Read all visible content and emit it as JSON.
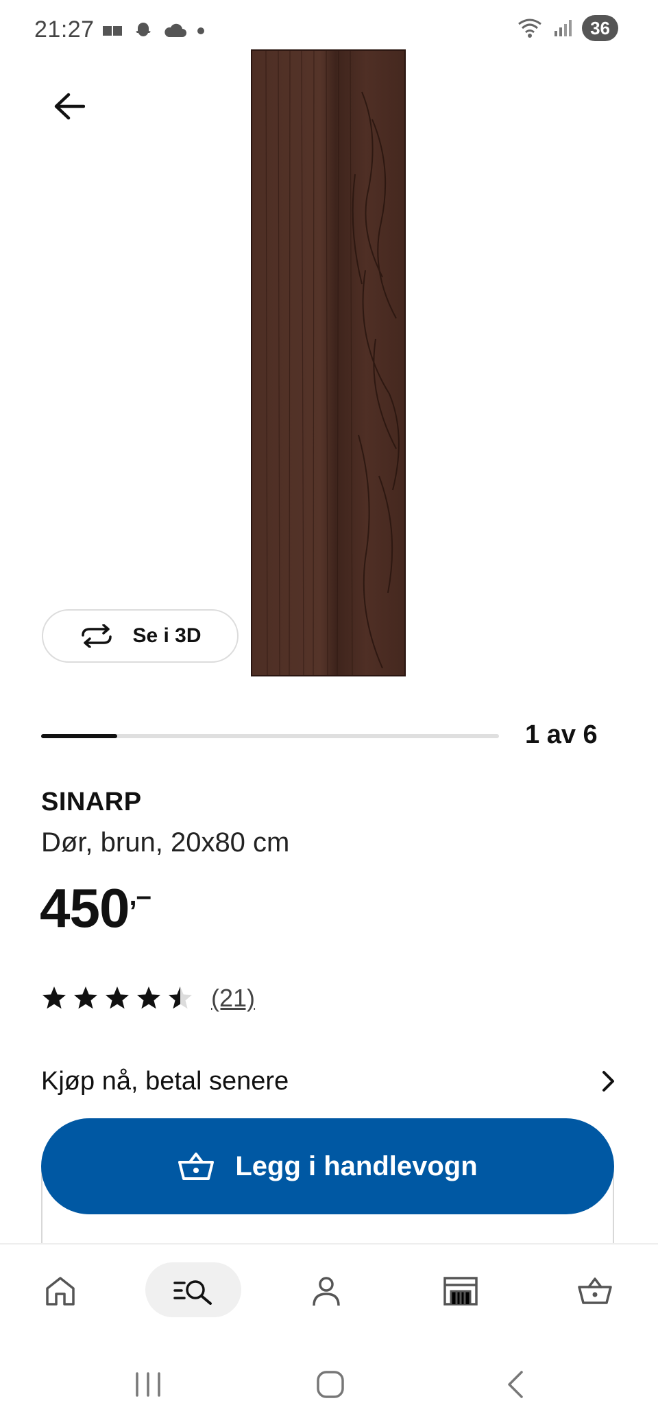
{
  "status_bar": {
    "time": "21:27",
    "battery": "36",
    "icons_left": [
      "message-icon",
      "snapchat-icon",
      "cloud-icon",
      "dot-icon"
    ],
    "icons_right": [
      "wifi-icon",
      "signal-icon"
    ]
  },
  "gallery": {
    "view_3d_label": "Se i 3D",
    "page_indicator": "1 av 6",
    "current": 1,
    "total": 6
  },
  "product": {
    "name": "SINARP",
    "description": "Dør, brun, 20x80 cm",
    "price": "450",
    "price_suffix": ",–",
    "rating": 4.5,
    "rating_max": 5,
    "review_count": "(21)"
  },
  "payment": {
    "buy_now_label": "Kjøp nå, betal senere"
  },
  "cart": {
    "add_label": "Legg i handlevogn"
  },
  "bottom_nav": {
    "items": [
      "home-icon",
      "search-icon",
      "profile-icon",
      "store-icon",
      "cart-icon"
    ],
    "active": "search-icon"
  },
  "colors": {
    "primary": "#0058a3",
    "wood": "#4a2c22",
    "text": "#111111"
  }
}
